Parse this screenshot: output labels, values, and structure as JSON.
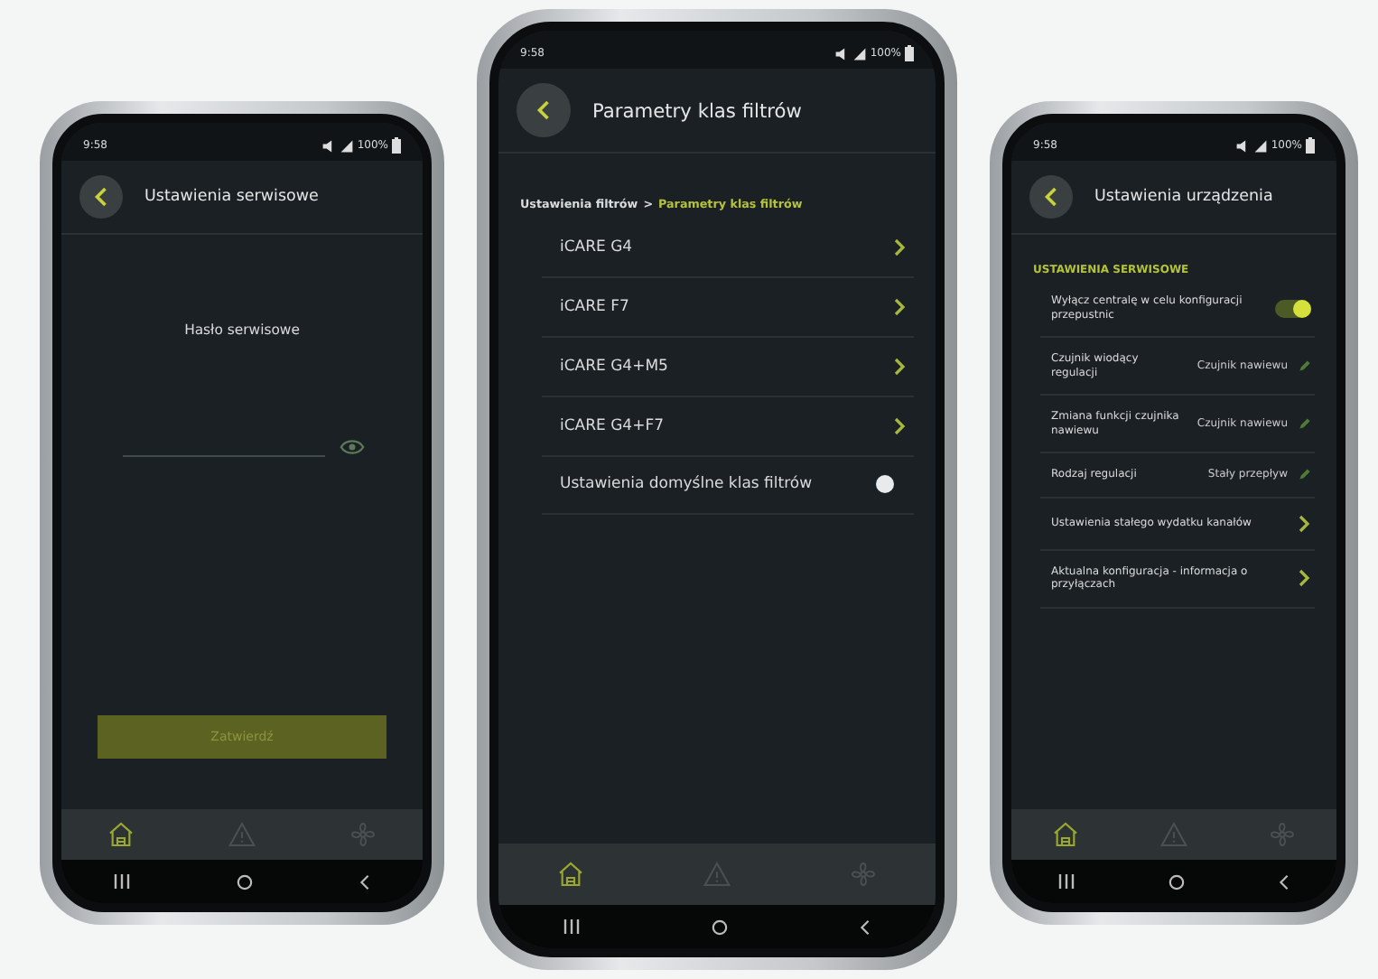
{
  "phones": [
    {
      "status_bar": {
        "time": "9:58",
        "battery": "100%"
      },
      "title": "Ustawienia serwisowe",
      "items": [
        {
          "kind": "heading",
          "text": "Hasło serwisowe"
        },
        {
          "kind": "password_field"
        },
        {
          "kind": "submit",
          "text": "Zatwierdź"
        }
      ],
      "nav_tabs": [
        {
          "kind": "home",
          "selected": true
        },
        {
          "kind": "warning",
          "selected": false
        },
        {
          "kind": "fan",
          "selected": false
        }
      ]
    },
    {
      "status_bar": {
        "time": "9:58",
        "battery": "100%"
      },
      "title": "Parametry klas filtrów",
      "items": [
        {
          "kind": "breadcrumb",
          "parent": "Ustawienia filtrów",
          "separator": ">",
          "current": "Parametry klas filtrów"
        },
        {
          "kind": "nav_row",
          "text": "iCARE G4"
        },
        {
          "kind": "nav_row",
          "text": "iCARE F7"
        },
        {
          "kind": "nav_row",
          "text": "iCARE G4+M5"
        },
        {
          "kind": "nav_row",
          "text": "iCARE G4+F7"
        },
        {
          "kind": "toggle_row",
          "text": "Ustawienia domyślne klas filtrów",
          "on": false
        }
      ],
      "nav_tabs": [
        {
          "kind": "home",
          "selected": true
        },
        {
          "kind": "warning",
          "selected": false
        },
        {
          "kind": "fan",
          "selected": false
        }
      ]
    },
    {
      "status_bar": {
        "time": "9:58",
        "battery": "100%"
      },
      "title": "Ustawienia urządzenia",
      "items": [
        {
          "kind": "section",
          "text": "USTAWIENIA SERWISOWE"
        },
        {
          "kind": "toggle_row",
          "text": "Wyłącz centralę w celu konfiguracji przepustnic",
          "on": true
        },
        {
          "kind": "value_row",
          "text": "Czujnik wiodący regulacji",
          "value": "Czujnik nawiewu"
        },
        {
          "kind": "value_row",
          "text": "Zmiana funkcji czujnika nawiewu",
          "value": "Czujnik nawiewu"
        },
        {
          "kind": "value_row",
          "text": "Rodzaj regulacji",
          "value": "Stały przepływ"
        },
        {
          "kind": "nav_row",
          "text": "Ustawienia stałego wydatku kanałów"
        },
        {
          "kind": "nav_row",
          "text": "Aktualna konfiguracja - informacja o przyłączach"
        }
      ],
      "nav_tabs": [
        {
          "kind": "home",
          "selected": true
        },
        {
          "kind": "warning",
          "selected": false
        },
        {
          "kind": "fan",
          "selected": false
        }
      ]
    }
  ]
}
